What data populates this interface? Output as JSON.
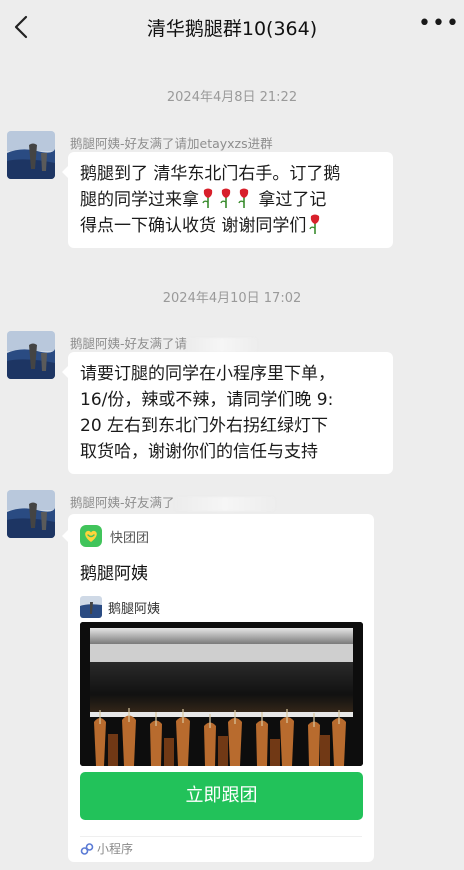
{
  "header": {
    "title": "清华鹅腿群10(364)"
  },
  "messages": [
    {
      "timestamp": "2024年4月8日 21:22",
      "sender": "鹅腿阿姨-好友满了请加etayxzs进群",
      "text_1": "鹅腿到了 清华东北门右手。订了鹅",
      "text_2": "腿的同学过来拿",
      "text_3": "拿过了记",
      "text_4": "得点一下确认收货 谢谢同学们"
    },
    {
      "timestamp": "2024年4月10日 17:02",
      "sender": "鹅腿阿姨-好友满了请",
      "lines": [
        "请要订腿的同学在小程序里下单，",
        "16/份，辣或不辣，请同学们晚 9:",
        "20 左右到东北门外右拐红绿灯下",
        "取货哈，谢谢你们的信任与支持"
      ]
    },
    {
      "sender": "鹅腿阿姨-好友满了",
      "card": {
        "app_name": "快团团",
        "title": "鹅腿阿姨",
        "shop_name": "鹅腿阿姨",
        "button_label": "立即跟团",
        "footer_label": "小程序"
      }
    }
  ],
  "colors": {
    "background": "#ededed",
    "bubble": "#ffffff",
    "button_green": "#22c25a",
    "timestamp_gray": "#9a9a9a"
  }
}
